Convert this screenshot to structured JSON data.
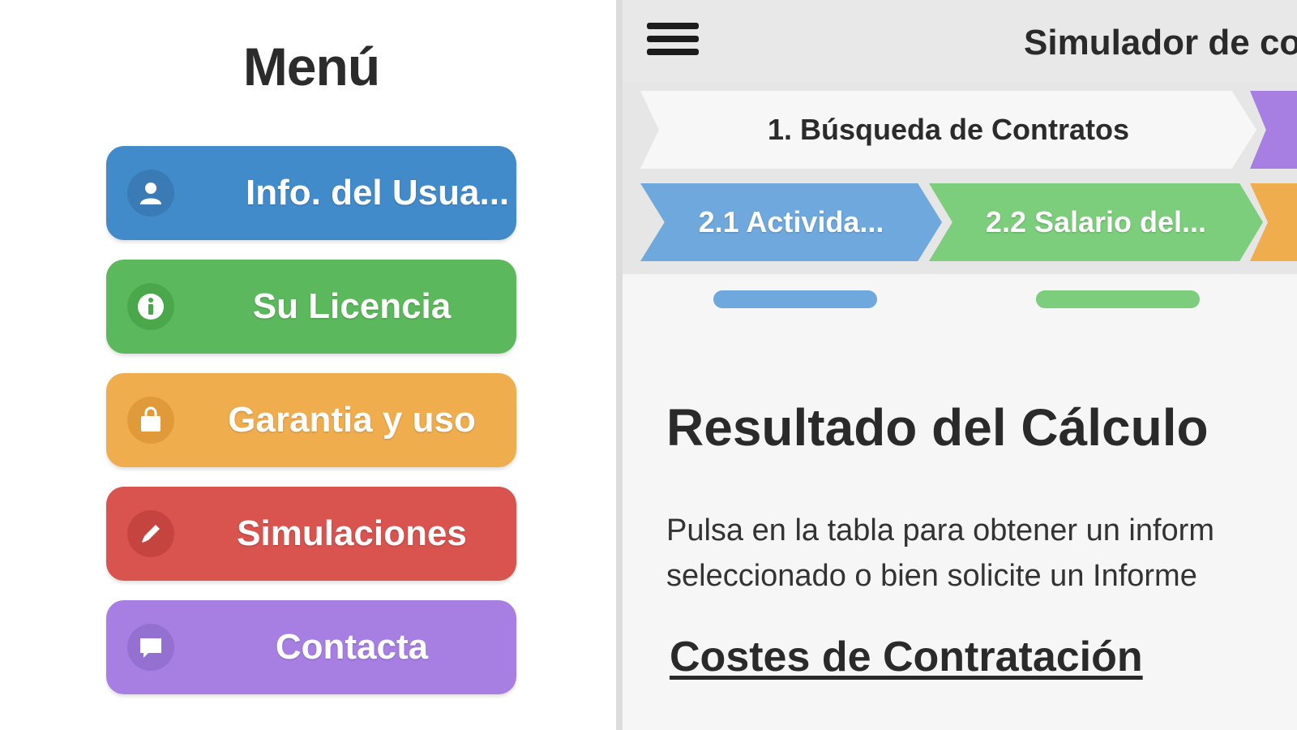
{
  "menu": {
    "title": "Menú",
    "items": [
      {
        "label": "Info. del Usua...",
        "icon": "user-icon",
        "color": "#428bca"
      },
      {
        "label": "Su Licencia",
        "icon": "info-icon",
        "color": "#5cb85c"
      },
      {
        "label": "Garantia y uso",
        "icon": "bag-icon",
        "color": "#f0ad4e"
      },
      {
        "label": "Simulaciones",
        "icon": "pencil-icon",
        "color": "#d9534f"
      },
      {
        "label": "Contacta",
        "icon": "chat-icon",
        "color": "#a77fe3"
      }
    ]
  },
  "header": {
    "title": "Simulador de co",
    "menu_icon": "hamburger-icon"
  },
  "steps": {
    "step1": "1. Búsqueda de Contratos",
    "step2_1": "2.1 Activida...",
    "step2_2": "2.2 Salario del..."
  },
  "main": {
    "result_title": "Resultado del Cálculo",
    "description_line1": "Pulsa en la tabla para obtener un inform",
    "description_line2": "seleccionado o bien solicite un Informe",
    "costs_title": "Costes de Contratación"
  }
}
